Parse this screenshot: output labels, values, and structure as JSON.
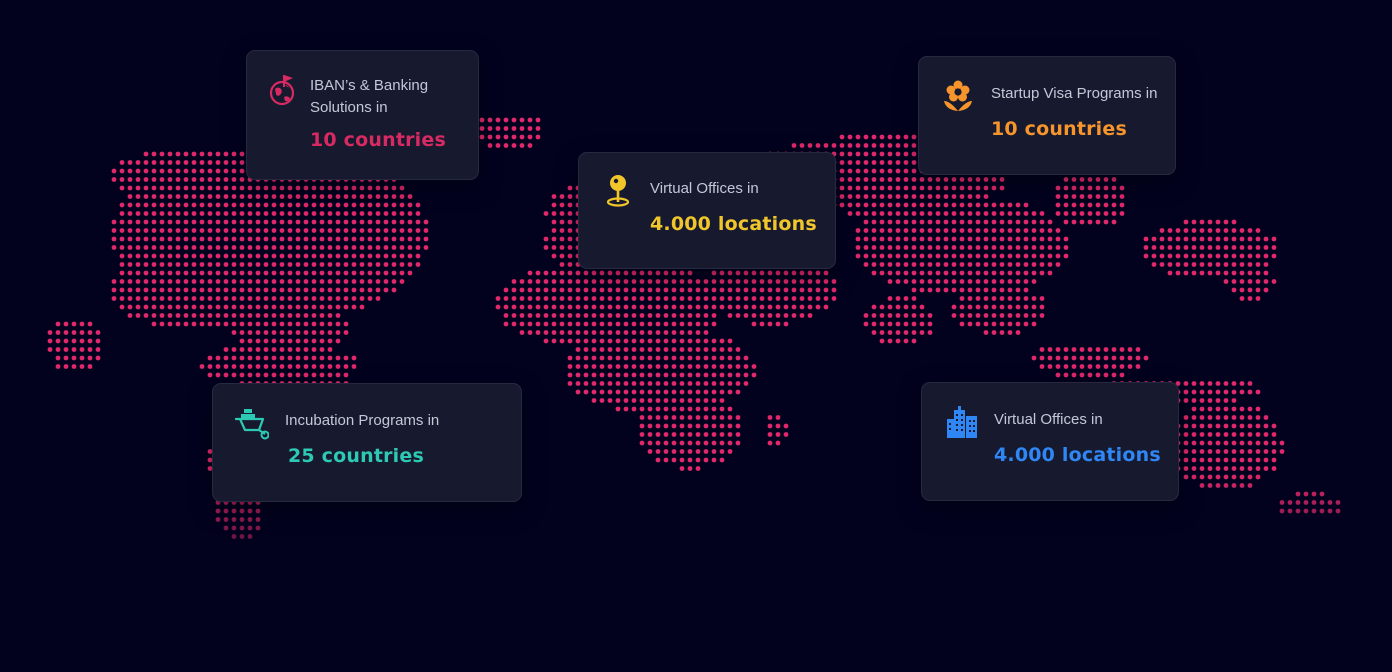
{
  "colors": {
    "background": "#02021f",
    "map_dot": "#e0286a",
    "card_bg": "#171a2e",
    "label_text": "#c3c7d6"
  },
  "cards": [
    {
      "id": "banking",
      "icon": "globe-flag-icon",
      "label": "IBAN’s & Banking Solutions in",
      "value": "10 countries",
      "color": "#d82a62"
    },
    {
      "id": "offices_center",
      "icon": "location-pin-icon",
      "label": "Virtual Offices in",
      "value": "4.000 locations",
      "color": "#f0c62a"
    },
    {
      "id": "startup",
      "icon": "flower-icon",
      "label": "Startup Visa Programs in",
      "value": "10 countries",
      "color": "#f7952c"
    },
    {
      "id": "incubation",
      "icon": "wheelbarrow-icon",
      "label": "Incubation Programs in",
      "value": "25 countries",
      "color": "#2ec9b4"
    },
    {
      "id": "offices_right",
      "icon": "city-buildings-icon",
      "label": "Virtual Offices in",
      "value": "4.000 locations",
      "color": "#2f86f5"
    }
  ]
}
